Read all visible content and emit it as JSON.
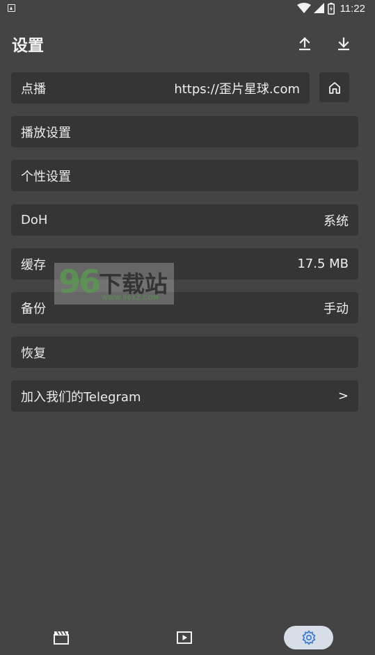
{
  "status_bar": {
    "time": "11:22"
  },
  "header": {
    "title": "设置"
  },
  "vod": {
    "label": "点播",
    "value": "https://歪片星球.com"
  },
  "settings_rows": [
    {
      "label": "播放设置",
      "value": ""
    },
    {
      "label": "个性设置",
      "value": ""
    },
    {
      "label": "DoH",
      "value": "系统"
    },
    {
      "label": "缓存",
      "value": "17.5 MB"
    },
    {
      "label": "备份",
      "value": "手动"
    },
    {
      "label": "恢复",
      "value": ""
    },
    {
      "label": "加入我们的Telegram",
      "value": ">"
    }
  ],
  "watermark": {
    "logo_number": "96",
    "site_name": "下载站",
    "url": "WWW.96XZ.COM"
  },
  "bottom_nav": [
    {
      "icon": "clapperboard-icon",
      "active": false
    },
    {
      "icon": "play-screen-icon",
      "active": false
    },
    {
      "icon": "gear-icon",
      "active": true
    }
  ],
  "colors": {
    "background": "#444444",
    "row": "#353535",
    "active_nav": "#d7dee7",
    "active_icon": "#3d7fd1"
  }
}
